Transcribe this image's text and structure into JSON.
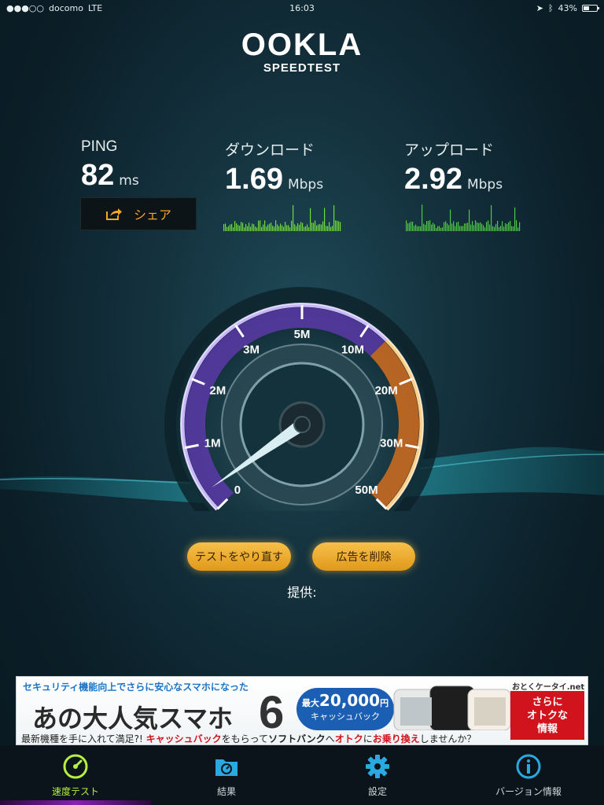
{
  "status_bar": {
    "signal_dots": "●●●○○",
    "carrier": "docomo",
    "network": "LTE",
    "time": "16:03",
    "battery": "43%",
    "battery_level": 0.43
  },
  "logo": {
    "brand": "OOKLA",
    "subtitle": "SPEEDTEST"
  },
  "metrics": {
    "ping": {
      "label": "PING",
      "value": "82",
      "unit": "ms"
    },
    "download": {
      "label": "ダウンロード",
      "value": "1.69",
      "unit": "Mbps"
    },
    "upload": {
      "label": "アップロード",
      "value": "2.92",
      "unit": "Mbps"
    }
  },
  "share_button": {
    "label": "シェア"
  },
  "gauge": {
    "tick_labels": [
      "0",
      "1M",
      "2M",
      "3M",
      "5M",
      "10M",
      "20M",
      "30M",
      "50M"
    ],
    "needle_value_mbps": 0.3
  },
  "buttons": {
    "retest": "テストをやり直す",
    "remove_ads": "広告を削除"
  },
  "provider_label": "提供:",
  "ad": {
    "top_line": "セキュリティ機能向上でさらに安心なスマホになった",
    "headline": "あの大人気スマホ",
    "number": "6",
    "bubble_prefix": "最大",
    "bubble_amount": "20,000",
    "bubble_currency": "円",
    "bubble_sub": "キャッシュバック",
    "brand": "おとくケータイ.net",
    "cta_line1": "さらに",
    "cta_line2": "オトクな",
    "cta_line3": "情報",
    "bottom_a": "最新機種を手に入れて満足?! ",
    "bottom_b": "キャッシュバック",
    "bottom_c": "をもらって",
    "bottom_d": "ソフトバンク",
    "bottom_e": "へ",
    "bottom_f": "オトク",
    "bottom_g": "に",
    "bottom_h": "お乗り換え",
    "bottom_i": "しませんか？"
  },
  "tabs": [
    {
      "label": "速度テスト",
      "icon": "speedometer-icon",
      "active": true
    },
    {
      "label": "結果",
      "icon": "folder-results-icon",
      "active": false
    },
    {
      "label": "設定",
      "icon": "gear-icon",
      "active": false
    },
    {
      "label": "バージョン情報",
      "icon": "info-icon",
      "active": false
    }
  ],
  "colors": {
    "accent_green": "#b6f040",
    "button_orange": "#f5a623",
    "gauge_purple": "#8b5cf6",
    "gauge_orange": "#f0892a",
    "tab_blue": "#2aa8e0"
  }
}
